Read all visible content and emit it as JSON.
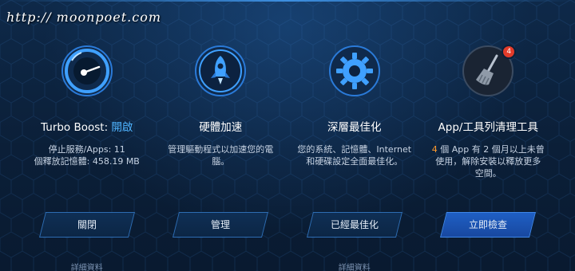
{
  "watermark": "http:// moonpoet.com",
  "columns": [
    {
      "icon": "speedometer-icon",
      "title_prefix": "Turbo Boost: ",
      "title_highlight": "開啟",
      "desc_lines": [
        "停止服務/Apps: 11",
        "個釋放記憶體: 458.19 MB"
      ],
      "button": "關閉",
      "link": "詳細資料"
    },
    {
      "icon": "rocket-icon",
      "title": "硬體加速",
      "desc_lines": [
        "管理驅動程式以加速您的電",
        "腦。"
      ],
      "button": "管理"
    },
    {
      "icon": "gear-icon",
      "title": "深層最佳化",
      "desc_lines": [
        "您的系統、記憶體、Internet",
        "和硬碟設定全面最佳化。"
      ],
      "button": "已經最佳化",
      "link": "詳細資料"
    },
    {
      "icon": "broom-icon",
      "badge": "4",
      "title": "App/工具列清理工具",
      "desc_num": "4",
      "desc_rest": " 個 App 有 2 個月以上未曾",
      "desc_lines": [
        "使用，解除安裝以釋放更多",
        "空間。"
      ],
      "button": "立即檢查"
    }
  ],
  "colors": {
    "background": "#0b1f38",
    "accent_blue": "#4fb4ff",
    "primary_button": "#1f5fc4",
    "badge_red": "#e23b2a",
    "count_orange": "#ff9a2e"
  }
}
